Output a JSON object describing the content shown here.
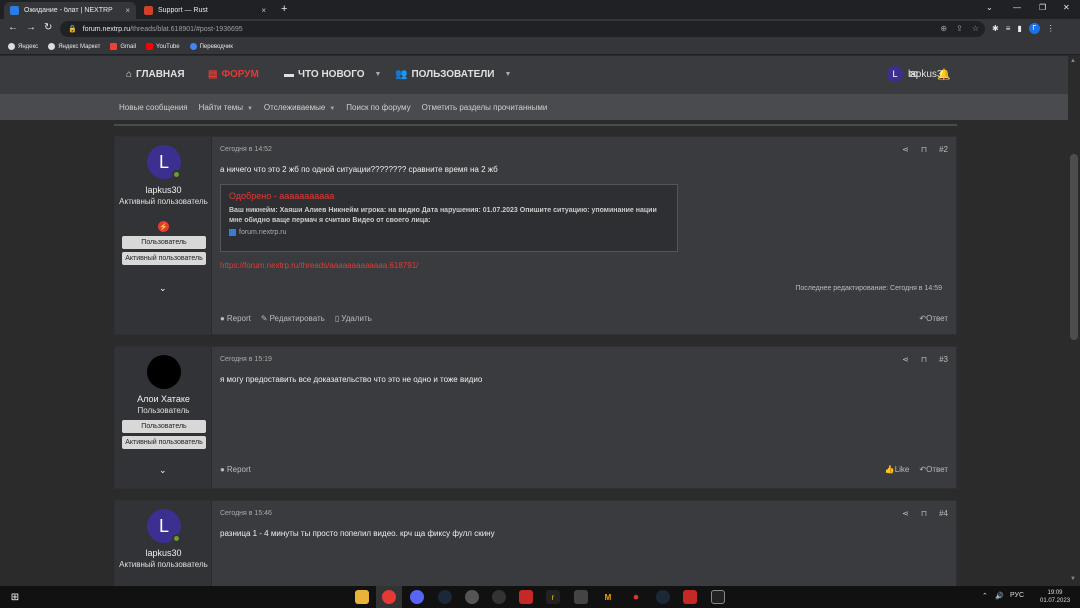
{
  "browser": {
    "tabs": [
      {
        "title": "Ожидание - блат | NEXTRP",
        "close": "×"
      },
      {
        "title": "Support — Rust",
        "close": "×"
      }
    ],
    "new_tab": "+",
    "win": {
      "minimize": "⌄",
      "min": "—",
      "restore": "❐",
      "close": "✕"
    },
    "url_host": "forum.nextrp.ru",
    "url_path": "/threads/blat.618901/#post-1936695",
    "bookmarks": [
      "Яндекс",
      "Яндекс Маркет",
      "Gmail",
      "YouTube",
      "Переводчик"
    ],
    "profile_letter": "Г"
  },
  "forum": {
    "nav": [
      {
        "label": "ГЛАВНАЯ"
      },
      {
        "label": "ФОРУМ"
      },
      {
        "label": "ЧТО НОВОГО"
      },
      {
        "label": "ПОЛЬЗОВАТЕЛИ"
      }
    ],
    "current_user": {
      "name": "lapkus30",
      "initial": "L"
    },
    "subnav": [
      "Новые сообщения",
      "Найти темы",
      "Отслеживаемые",
      "Поиск по форуму",
      "Отметить разделы прочитанными"
    ]
  },
  "posts": [
    {
      "author": "lapkus30",
      "initial": "L",
      "user_title": "Активный пользователь",
      "banners": [
        "Пользователь",
        "Активный пользователь"
      ],
      "date": "Сегодня в 14:52",
      "number": "#2",
      "body": "а ничего что это 2 жб по одной ситуации???????? сравните время на 2 жб",
      "quote": {
        "title": "Одобрено - ааааааааааа",
        "text": "Ваш никнейм: Хаяши Алиев Никнейм игрока: на видио Дата нарушения: 01.07.2023 Опишите ситуацию: упоминание нации мне обидно ваще пермач я считаю Видео от своего лица:",
        "source": "forum.nextrp.ru"
      },
      "link": "https://forum.nextrp.ru/threads/aaaaaaaaaaaaa.618791/",
      "edited": "Последнее редактирование: Сегодня в 14:59",
      "actions": [
        "Report",
        "Редактировать",
        "Удалить"
      ],
      "reply": "Ответ"
    },
    {
      "author": "Алои Хатаке",
      "user_title": "Пользователь",
      "banners": [
        "Пользователь",
        "Активный пользователь"
      ],
      "date": "Сегодня в 15:19",
      "number": "#3",
      "body": "я могу предоставить все доказательство что это не одно и тоже видио",
      "actions": [
        "Report"
      ],
      "like": "Like",
      "reply": "Ответ"
    },
    {
      "author": "lapkus30",
      "initial": "L",
      "user_title": "Активный пользователь",
      "date": "Сегодня в 15:46",
      "number": "#4",
      "body": "разница 1 - 4 минуты ты просто попелил видео. крч ща фиксу фулл скину"
    }
  ],
  "taskbar": {
    "lang": "РУС",
    "time": "19:09",
    "date": "01.07.2023"
  }
}
